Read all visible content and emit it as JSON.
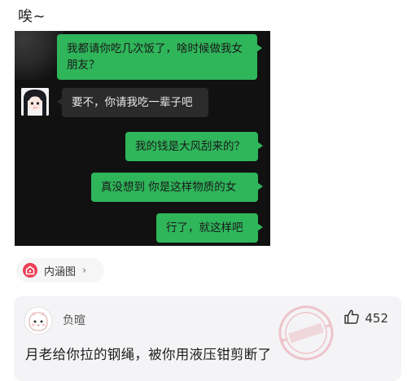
{
  "post": {
    "title": "唉~"
  },
  "chat": {
    "messages": [
      {
        "side": "me",
        "text": "我都请你吃几次饭了，啥时候做我女朋友？"
      },
      {
        "side": "other",
        "text": "要不，你请我吃一辈子吧"
      },
      {
        "side": "me",
        "text": "我的钱是大风刮来的？"
      },
      {
        "side": "me",
        "text": "真没想到 你是这样物质的女"
      },
      {
        "side": "me",
        "text": "行了，就这样吧"
      }
    ]
  },
  "related": {
    "label": "内涵图",
    "arrow": "›"
  },
  "comment": {
    "author": "负暄",
    "likes": "452",
    "text": "月老给你拉的钢绳，被你用液压钳剪断了"
  },
  "colors": {
    "bubble_me": "#2fb55a",
    "bubble_other": "#2b2b2b",
    "accent": "#ee3f57"
  },
  "icons": [
    "anime-avatar-icon",
    "related-tag-icon",
    "chevron-right-icon",
    "commenter-avatar-icon",
    "watermark-stamp-icon",
    "thumbs-up-icon"
  ]
}
